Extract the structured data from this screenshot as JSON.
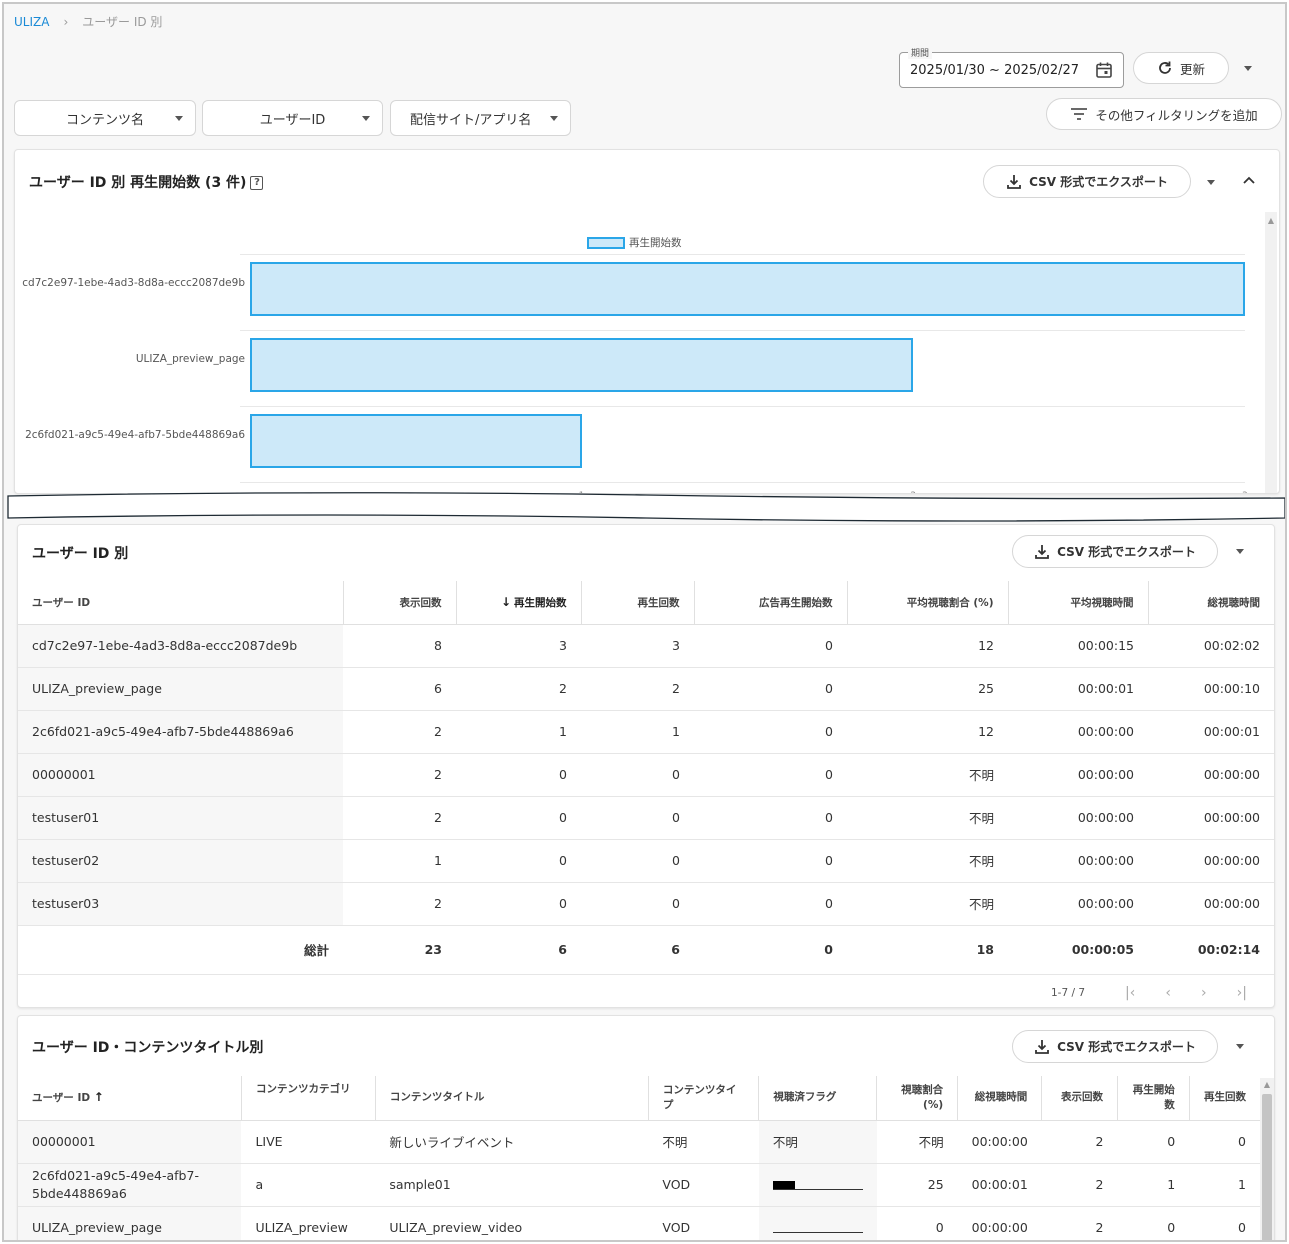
{
  "breadcrumb": {
    "root": "ULIZA",
    "separator": "›",
    "current": "ユーザー ID 別"
  },
  "period": {
    "label": "期間",
    "value": "2025/01/30 ~ 2025/02/27"
  },
  "refresh": {
    "label": "更新"
  },
  "filters": [
    {
      "label": "コンテンツ名"
    },
    {
      "label": "ユーザーID"
    },
    {
      "label": "配信サイト/アプリ名"
    }
  ],
  "add_filter": {
    "label": "その他フィルタリングを追加"
  },
  "chart_card": {
    "title": "ユーザー ID 別 再生開始数 (3 件)",
    "export": "CSV 形式でエクスポート"
  },
  "chart_data": {
    "type": "bar",
    "orientation": "horizontal",
    "legend": "再生開始数",
    "categories": [
      "cd7c2e97-1ebe-4ad3-8d8a-eccc2087de9b",
      "ULIZA_preview_page",
      "2c6fd021-a9c5-49e4-afb7-5bde448869a6"
    ],
    "series": [
      {
        "name": "再生開始数",
        "values": [
          3,
          2,
          1
        ]
      }
    ],
    "xlim": [
      0,
      3
    ],
    "x_ticks": [
      "1",
      "2",
      "3"
    ],
    "colors": {
      "fill": "#cde9f9",
      "stroke": "#2aa6e8"
    }
  },
  "table1": {
    "title": "ユーザー ID 別",
    "export": "CSV 形式でエクスポート",
    "columns": [
      "ユーザー ID",
      "表示回数",
      "再生開始数",
      "再生回数",
      "広告再生開始数",
      "平均視聴割合 (%)",
      "平均視聴時間",
      "総視聴時間"
    ],
    "sort_icon": "↓",
    "rows": [
      [
        "cd7c2e97-1ebe-4ad3-8d8a-eccc2087de9b",
        "8",
        "3",
        "3",
        "0",
        "12",
        "00:00:15",
        "00:02:02"
      ],
      [
        "ULIZA_preview_page",
        "6",
        "2",
        "2",
        "0",
        "25",
        "00:00:01",
        "00:00:10"
      ],
      [
        "2c6fd021-a9c5-49e4-afb7-5bde448869a6",
        "2",
        "1",
        "1",
        "0",
        "12",
        "00:00:00",
        "00:00:01"
      ],
      [
        "00000001",
        "2",
        "0",
        "0",
        "0",
        "不明",
        "00:00:00",
        "00:00:00"
      ],
      [
        "testuser01",
        "2",
        "0",
        "0",
        "0",
        "不明",
        "00:00:00",
        "00:00:00"
      ],
      [
        "testuser02",
        "1",
        "0",
        "0",
        "0",
        "不明",
        "00:00:00",
        "00:00:00"
      ],
      [
        "testuser03",
        "2",
        "0",
        "0",
        "0",
        "不明",
        "00:00:00",
        "00:00:00"
      ]
    ],
    "total": [
      "総計",
      "23",
      "6",
      "6",
      "0",
      "18",
      "00:00:05",
      "00:02:14"
    ],
    "pagination": "1-7 / 7"
  },
  "table2": {
    "title": "ユーザー ID・コンテンツタイトル別",
    "export": "CSV 形式でエクスポート",
    "columns": [
      "ユーザー ID",
      "コンテンツカテゴリ",
      "コンテンツタイトル",
      "コンテンツタイプ",
      "視聴済フラグ",
      "視聴割合 (%)",
      "総視聴時間",
      "表示回数",
      "再生開始数",
      "再生回数"
    ],
    "sort_icon": "↑",
    "rows": [
      {
        "user": "00000001",
        "cat": "LIVE",
        "title": "新しいライブイベント",
        "type": "不明",
        "flag": "不明",
        "flag_ratio": null,
        "ratio": "不明",
        "time": "00:00:00",
        "views": "2",
        "starts": "0",
        "plays": "0"
      },
      {
        "user": "2c6fd021-a9c5-49e4-afb7-5bde448869a6",
        "cat": "a",
        "title": "sample01",
        "type": "VOD",
        "flag": "",
        "flag_ratio": 0.25,
        "ratio": "25",
        "time": "00:00:01",
        "views": "2",
        "starts": "1",
        "plays": "1"
      },
      {
        "user": "ULIZA_preview_page",
        "cat": "ULIZA_preview",
        "title": "ULIZA_preview_video",
        "type": "VOD",
        "flag": "",
        "flag_ratio": 0,
        "ratio": "0",
        "time": "00:00:00",
        "views": "2",
        "starts": "0",
        "plays": "0"
      }
    ]
  }
}
